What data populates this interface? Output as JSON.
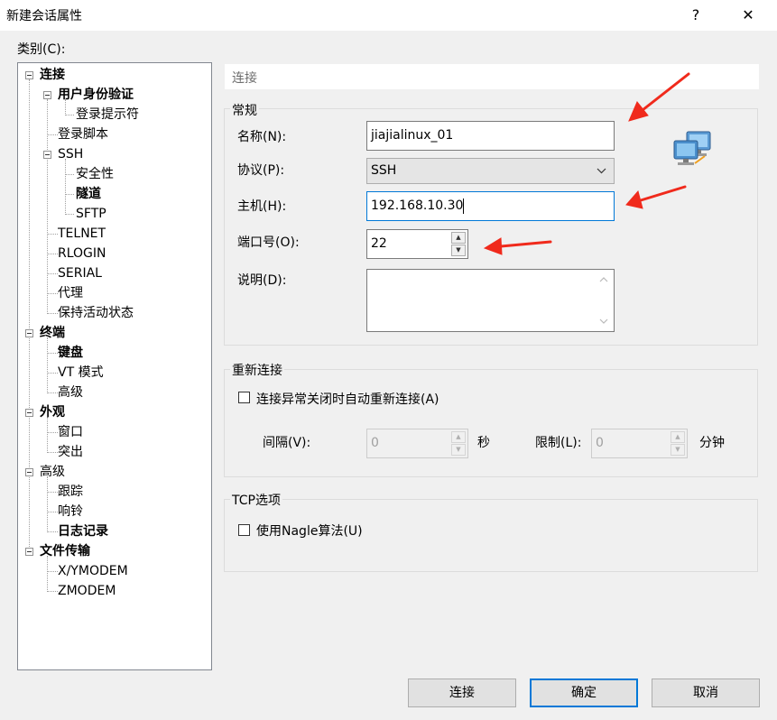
{
  "window": {
    "title": "新建会话属性",
    "help_label": "?",
    "close_label": "✕"
  },
  "category_label": "类别(C):",
  "tree": [
    {
      "label": "连接"
    },
    {
      "label": "用户身份验证"
    },
    {
      "label": "登录提示符"
    },
    {
      "label": "登录脚本"
    },
    {
      "label": "SSH"
    },
    {
      "label": "安全性"
    },
    {
      "label": "隧道"
    },
    {
      "label": "SFTP"
    },
    {
      "label": "TELNET"
    },
    {
      "label": "RLOGIN"
    },
    {
      "label": "SERIAL"
    },
    {
      "label": "代理"
    },
    {
      "label": "保持活动状态"
    },
    {
      "label": "终端"
    },
    {
      "label": "键盘"
    },
    {
      "label": "VT 模式"
    },
    {
      "label": "高级"
    },
    {
      "label": "外观"
    },
    {
      "label": "窗口"
    },
    {
      "label": "突出"
    },
    {
      "label": "高级"
    },
    {
      "label": "跟踪"
    },
    {
      "label": "响铃"
    },
    {
      "label": "日志记录"
    },
    {
      "label": "文件传输"
    },
    {
      "label": "X/YMODEM"
    },
    {
      "label": "ZMODEM"
    }
  ],
  "panel": {
    "header": "连接",
    "general": {
      "legend": "常规",
      "name_label": "名称(N):",
      "name_value": "jiajialinux_01",
      "protocol_label": "协议(P):",
      "protocol_value": "SSH",
      "host_label": "主机(H):",
      "host_value": "192.168.10.30",
      "port_label": "端口号(O):",
      "port_value": "22",
      "desc_label": "说明(D):",
      "desc_value": ""
    },
    "reconnect": {
      "legend": "重新连接",
      "checkbox_label": "连接异常关闭时自动重新连接(A)",
      "interval_label": "间隔(V):",
      "interval_value": "0",
      "interval_unit": "秒",
      "limit_label": "限制(L):",
      "limit_value": "0",
      "limit_unit": "分钟"
    },
    "tcp": {
      "legend": "TCP选项",
      "nagle_label": "使用Nagle算法(U)"
    }
  },
  "buttons": {
    "connect": "连接",
    "ok": "确定",
    "cancel": "取消"
  },
  "colors": {
    "accent": "#0078d7",
    "annotation_arrow": "#f02a1c"
  }
}
